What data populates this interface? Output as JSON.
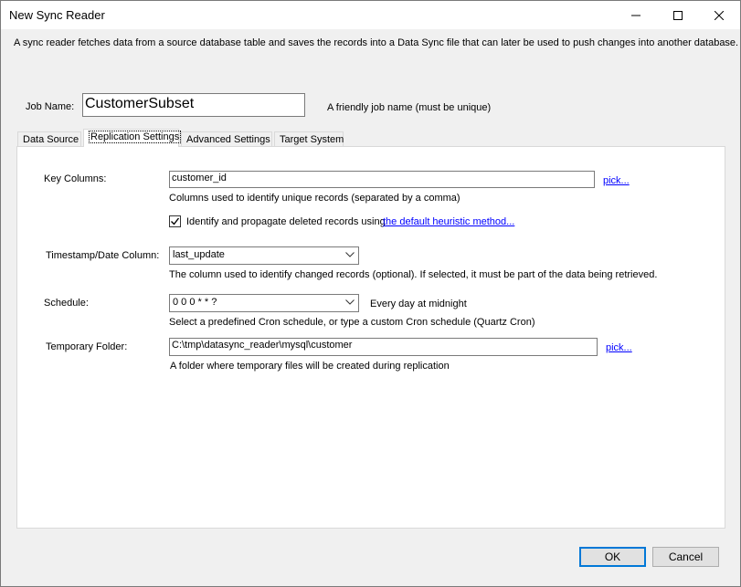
{
  "window": {
    "title": "New Sync Reader",
    "minimize_icon": "minimize-icon",
    "maximize_icon": "maximize-icon",
    "close_icon": "close-icon"
  },
  "intro_text": "A sync reader fetches data from a source database table and saves the records into a Data Sync file that can later be used to push changes into another database.",
  "job": {
    "label": "Job Name:",
    "value": "CustomerSubset",
    "hint": "A friendly job name (must be unique)"
  },
  "tabs": [
    {
      "label": "Data Source",
      "active": false
    },
    {
      "label": "Replication Settings",
      "active": true
    },
    {
      "label": "Advanced Settings",
      "active": false
    },
    {
      "label": "Target System",
      "active": false
    }
  ],
  "key_columns": {
    "label": "Key Columns:",
    "value": "customer_id",
    "pick_label": "pick...",
    "hint": "Columns used to identify unique records (separated by a comma)"
  },
  "deleted_records": {
    "checked": true,
    "label": "Identify and propagate deleted records using",
    "link": "the default heuristic method..."
  },
  "timestamp_column": {
    "label": "Timestamp/Date Column:",
    "value": "last_update",
    "hint": "The column used to identify changed records (optional). If selected, it must be part of the data being retrieved."
  },
  "schedule": {
    "label": "Schedule:",
    "value": "0 0 0 * * ?",
    "description": "Every day at midnight",
    "hint": "Select a predefined Cron schedule, or type a custom Cron schedule (Quartz Cron)"
  },
  "temp_folder": {
    "label": "Temporary Folder:",
    "value": "C:\\tmp\\datasync_reader\\mysql\\customer",
    "pick_label": "pick...",
    "hint": "A folder where temporary files will be created during replication"
  },
  "buttons": {
    "ok": "OK",
    "cancel": "Cancel"
  },
  "colors": {
    "link": "#0000ff",
    "default_button_border": "#0078d7",
    "checkbox_check": "#000000"
  }
}
